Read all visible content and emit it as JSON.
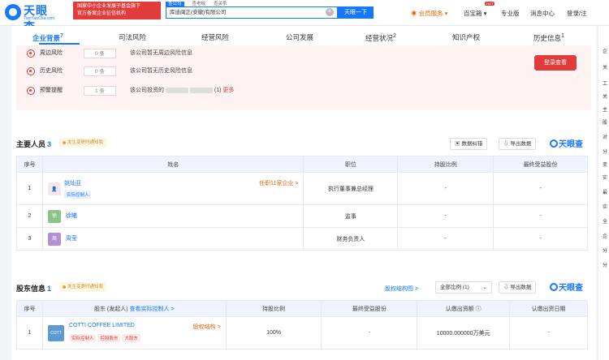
{
  "brand": {
    "name": "天眼查",
    "sub": "TianYanCha.com",
    "color": "#1677ff"
  },
  "promo": {
    "line1": "国家中小企业发展子基金旗下",
    "line2": "官方备案企业征信机构"
  },
  "search_tabs": [
    "查公司",
    "查老板",
    "查关系"
  ],
  "search": {
    "value": "库迪闽正(安徽)有限公司",
    "button": "天眼一下"
  },
  "nav": {
    "vip": "会员服务",
    "hot": "HOT",
    "treasure": "百宝箱",
    "pro": "专业版",
    "msg": "消息中心",
    "login": "登录/注"
  },
  "tabs": [
    {
      "label": "企业背景",
      "sup": "7"
    },
    {
      "label": "司法风险",
      "sup": ""
    },
    {
      "label": "经营风险",
      "sup": ""
    },
    {
      "label": "公司发展",
      "sup": ""
    },
    {
      "label": "经营状况",
      "sup": "2"
    },
    {
      "label": "知识产权",
      "sup": ""
    },
    {
      "label": "历史信息",
      "sup": "1"
    }
  ],
  "risks": [
    {
      "label": "周边风险",
      "count": "0 条",
      "text": "该公司暂无周边风险信息"
    },
    {
      "label": "历史风险",
      "count": "0 条",
      "text": "该公司暂无历史风险信息"
    },
    {
      "label": "预警提醒",
      "count": "1 条",
      "text": "该公司投资的",
      "suffix": "(1)",
      "more": "更多"
    }
  ],
  "login_button": "登录查看",
  "personnel": {
    "title": "主要人员",
    "count": "3",
    "chip": "发生变更时通知我",
    "btn_graph": "数据纠错",
    "btn_export": "导出数据",
    "logo": "天眼查",
    "headers": [
      "序号",
      "姓名",
      "职位",
      "持股比例",
      "最终受益股份"
    ],
    "rows": [
      {
        "idx": "1",
        "name": "姚灿亚",
        "tag": "实际控制人",
        "extra": "任职11家企业 >",
        "position": "执行董事兼总经理",
        "share": "-",
        "benefit": "-",
        "avatar_color": "#8e7cc3"
      },
      {
        "idx": "2",
        "name": "徐曦",
        "avatar": "徐",
        "position": "监事",
        "share": "-",
        "benefit": "-",
        "avatar_color": "#8bc48a"
      },
      {
        "idx": "3",
        "name": "周莹",
        "avatar": "周",
        "position": "财务负责人",
        "share": "-",
        "benefit": "-",
        "avatar_color": "#b48fd1"
      }
    ]
  },
  "shareholders": {
    "title": "股东信息",
    "count": "1",
    "chip": "发生变更时通知我",
    "link": "股权结构图 >",
    "select": "全部比例 (1)",
    "btn_export": "导出数据",
    "logo": "天眼查",
    "headers": [
      "序号",
      "股东 (发起人)",
      "查看实际控制人 >",
      "持股比例",
      "最终受益股份",
      "认缴出资额 ⓘ",
      "认缴出资日期"
    ],
    "rows": [
      {
        "idx": "1",
        "avatar": "COTT",
        "name": "COTTI COFFEE LIMITED",
        "tags": [
          "实际控制人",
          "控股股东",
          "大股东"
        ],
        "link": "股权结构 >",
        "share": "100%",
        "benefit": "-",
        "capital": "10000.000000万美元",
        "date": "-"
      }
    ]
  },
  "right_panel": [
    "企",
    "关",
    "工",
    "关",
    "主",
    "股",
    "对",
    "分",
    "变",
    "实",
    "最",
    "实",
    "全",
    "企",
    "分",
    "分"
  ]
}
